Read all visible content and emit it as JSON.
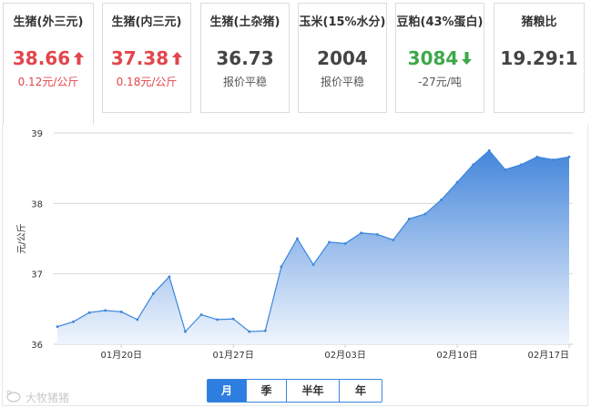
{
  "cards": [
    {
      "title": "生猪(外三元)",
      "price": "38.66",
      "direction": "up",
      "change": "0.12元/公斤",
      "active": true
    },
    {
      "title": "生猪(内三元)",
      "price": "37.38",
      "direction": "up",
      "change": "0.18元/公斤",
      "active": false
    },
    {
      "title": "生猪(土杂猪)",
      "price": "36.73",
      "direction": "flat",
      "change": "报价平稳",
      "active": false
    },
    {
      "title": "玉米(15%水分)",
      "price": "2004",
      "direction": "flat",
      "change": "报价平稳",
      "active": false
    },
    {
      "title": "豆粕(43%蛋白)",
      "price": "3084",
      "direction": "down",
      "change": "-27元/吨",
      "active": false
    },
    {
      "title": "猪粮比",
      "price": "19.29:1",
      "direction": "none",
      "change": "",
      "active": false
    }
  ],
  "colors": {
    "up": "#e2454d",
    "down": "#3ea84a",
    "line": "#3a86dd",
    "area_top": "#3a7fd9",
    "area_bottom": "#eef4fc"
  },
  "chart_data": {
    "type": "area",
    "ylabel": "元/公斤",
    "xlabel": "",
    "ylim": [
      36,
      39
    ],
    "yticks": [
      36,
      37,
      38,
      39
    ],
    "xticks": [
      "01月20日",
      "01月27日",
      "02月03日",
      "02月10日",
      "02月17日"
    ],
    "grid": true,
    "series": [
      {
        "x": [
          "01月16日",
          "01月17日",
          "01月18日",
          "01月19日",
          "01月20日",
          "01月21日",
          "01月22日",
          "01月23日",
          "01月24日",
          "01月25日",
          "01月26日",
          "01月27日",
          "01月28日",
          "01月29日",
          "01月30日",
          "01月31日",
          "02月01日",
          "02月02日",
          "02月03日",
          "02月04日",
          "02月05日",
          "02月06日",
          "02月07日",
          "02月08日",
          "02月09日",
          "02月10日",
          "02月11日",
          "02月12日",
          "02月13日",
          "02月14日",
          "02月15日",
          "02月16日",
          "02月17日"
        ],
        "values": [
          36.25,
          36.32,
          36.45,
          36.48,
          36.46,
          36.35,
          36.72,
          36.96,
          36.18,
          36.42,
          36.35,
          36.36,
          36.18,
          36.19,
          37.1,
          37.5,
          37.13,
          37.45,
          37.43,
          37.58,
          37.56,
          37.48,
          37.78,
          37.85,
          38.05,
          38.3,
          38.55,
          38.75,
          38.48,
          38.55,
          38.66,
          38.62,
          38.66
        ]
      }
    ]
  },
  "periods": [
    {
      "label": "月",
      "selected": true
    },
    {
      "label": "季",
      "selected": false
    },
    {
      "label": "半年",
      "selected": false
    },
    {
      "label": "年",
      "selected": false
    }
  ],
  "logo": {
    "text": "大牧猪猪"
  }
}
